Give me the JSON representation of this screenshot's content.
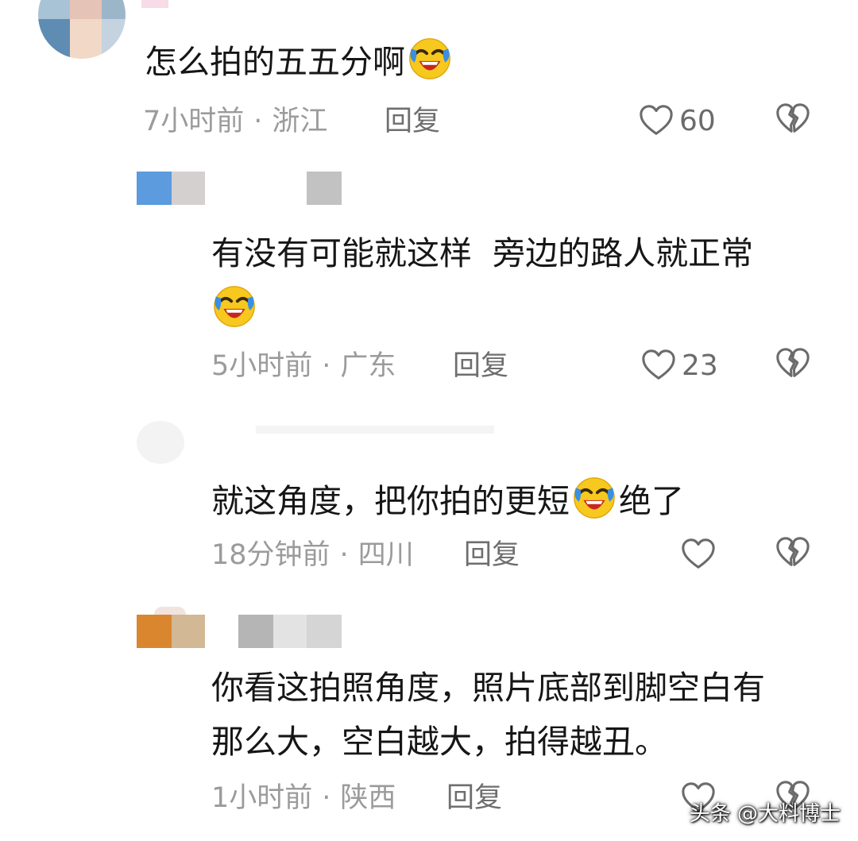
{
  "comments": [
    {
      "text": "怎么拍的五五分啊",
      "emoji": "laughing-tears-emoji",
      "time": "7小时前",
      "location": "浙江",
      "reply_label": "回复",
      "likes": "60"
    },
    {
      "text_line1": "有没有可能就这样  旁边的路人就正常",
      "emoji": "laughing-tears-emoji",
      "time": "5小时前",
      "location": "广东",
      "reply_label": "回复",
      "likes": "23"
    },
    {
      "text_before": "就这角度，把你拍的更短",
      "emoji": "laughing-tears-emoji",
      "text_after": "绝了",
      "time": "18分钟前",
      "location": "四川",
      "reply_label": "回复",
      "likes": ""
    },
    {
      "text_line1": "你看这拍照角度，照片底部到脚空白有",
      "text_line2": "那么大，空白越大，拍得越丑。",
      "time": "1小时前",
      "location": "陕西",
      "reply_label": "回复",
      "likes": ""
    }
  ],
  "separator": "·",
  "watermark": "头条 @大料博士",
  "icons": {
    "like": "heart-outline-icon",
    "dislike": "broken-heart-icon"
  },
  "colors": {
    "meta_gray": "#9b9b9b",
    "icon_gray": "#6b6b6b",
    "emoji_yellow": "#f7c81e",
    "emoji_blue": "#3b8fe0"
  }
}
